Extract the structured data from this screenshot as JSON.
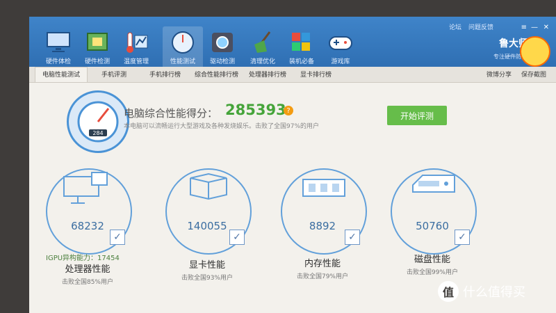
{
  "topbar": {
    "tools": [
      {
        "label": "硬件体检",
        "icon": "monitor-icon"
      },
      {
        "label": "硬件检测",
        "icon": "chip-icon"
      },
      {
        "label": "温度管理",
        "icon": "thermometer-icon"
      },
      {
        "label": "性能测试",
        "icon": "speedometer-icon"
      },
      {
        "label": "驱动检测",
        "icon": "gear-icon"
      },
      {
        "label": "清理优化",
        "icon": "broom-icon"
      },
      {
        "label": "装机必备",
        "icon": "package-icon"
      },
      {
        "label": "游戏库",
        "icon": "gamepad-icon"
      }
    ],
    "links": [
      "论坛",
      "问题反馈"
    ],
    "brand": "鲁大师",
    "brand_sub": "专注硬件防护"
  },
  "subtabs": {
    "items": [
      "电脑性能测试",
      "手机评测",
      "手机排行榜",
      "综合性能排行榜",
      "处理器排行榜",
      "显卡排行榜"
    ],
    "right": [
      "微博分享",
      "保存截图"
    ]
  },
  "score": {
    "label": "电脑综合性能得分：",
    "value": "285393",
    "description": "本电脑可以流畅运行大型游戏及各种发烧娱乐。击败了全国97%的用户",
    "gauge_value": "284",
    "button": "开始评测"
  },
  "metrics": [
    {
      "value": "68232",
      "title": "处理器性能",
      "sub": "击败全国85%用户",
      "extra": "IGPU异构能力：17454"
    },
    {
      "value": "140055",
      "title": "显卡性能",
      "sub": "击败全国93%用户"
    },
    {
      "value": "8892",
      "title": "内存性能",
      "sub": "击败全国79%用户"
    },
    {
      "value": "50760",
      "title": "磁盘性能",
      "sub": "击败全国99%用户"
    }
  ],
  "watermark": {
    "text": "什么值得买",
    "glyph": "值"
  },
  "colors": {
    "topbar": "#3f84c9",
    "score_green": "#45a43a",
    "button_green": "#66bd4a",
    "circle_blue": "#62a0da"
  }
}
